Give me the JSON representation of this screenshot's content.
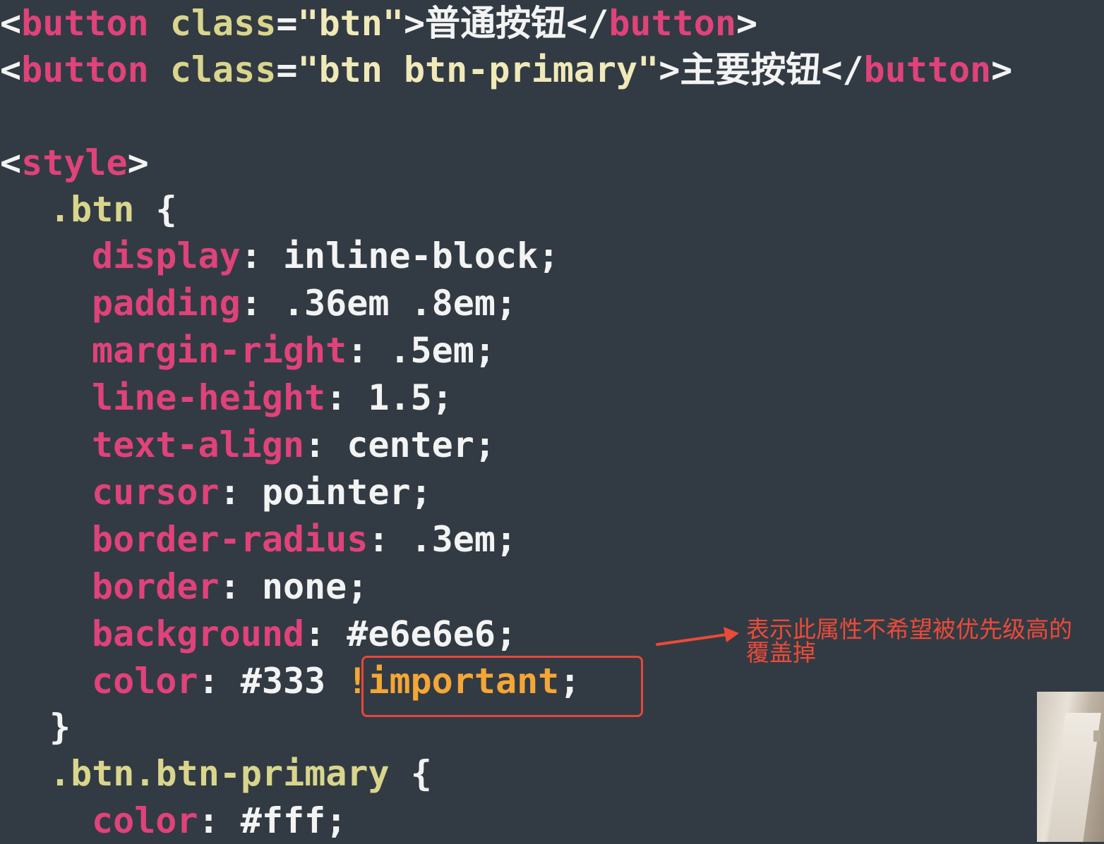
{
  "code": {
    "line1": {
      "open_bracket": "<",
      "tag": "button",
      "space": " ",
      "attr": "class",
      "eq": "=",
      "value": "\"btn\"",
      "close": ">",
      "text": "普通按钮",
      "end_open": "</",
      "end_tag": "button",
      "end_close": ">"
    },
    "line2": {
      "open_bracket": "<",
      "tag": "button",
      "space": " ",
      "attr": "class",
      "eq": "=",
      "value": "\"btn btn-primary\"",
      "close": ">",
      "text": "主要按钮",
      "end_open": "</",
      "end_tag": "button",
      "end_close": ">"
    },
    "style_open": {
      "lt": "<",
      "tag": "style",
      "gt": ">"
    },
    "btn_rule": {
      "selector": ".btn",
      "brace_open": " {",
      "declarations": [
        {
          "prop": "display",
          "colon": ": ",
          "value": "inline-block;"
        },
        {
          "prop": "padding",
          "colon": ": ",
          "value": ".36em .8em;"
        },
        {
          "prop": "margin-right",
          "colon": ": ",
          "value": ".5em;"
        },
        {
          "prop": "line-height",
          "colon": ": ",
          "value": "1.5;"
        },
        {
          "prop": "text-align",
          "colon": ": ",
          "value": "center;"
        },
        {
          "prop": "cursor",
          "colon": ": ",
          "value": "pointer;"
        },
        {
          "prop": "border-radius",
          "colon": ": ",
          "value": ".3em;"
        },
        {
          "prop": "border",
          "colon": ": ",
          "value": "none;"
        },
        {
          "prop": "background",
          "colon": ": ",
          "value": "#e6e6e6;"
        },
        {
          "prop": "color",
          "colon": ": ",
          "value": "#333 ",
          "important": "!important",
          "semicolon": ";"
        }
      ],
      "brace_close": "}"
    },
    "primary_rule": {
      "selector": ".btn.btn-primary",
      "brace_open": " {",
      "declarations": [
        {
          "prop": "color",
          "colon": ": ",
          "value": "#fff;"
        }
      ]
    }
  },
  "annotation": {
    "line1": "表示此属性不希望被优先级高的",
    "line2": "覆盖掉",
    "color": "#ec4a39"
  },
  "colors": {
    "background": "#323b43",
    "tag": "#e0427a",
    "selector": "#d9d58c",
    "important": "#f4a636",
    "highlight": "#e7463c"
  }
}
